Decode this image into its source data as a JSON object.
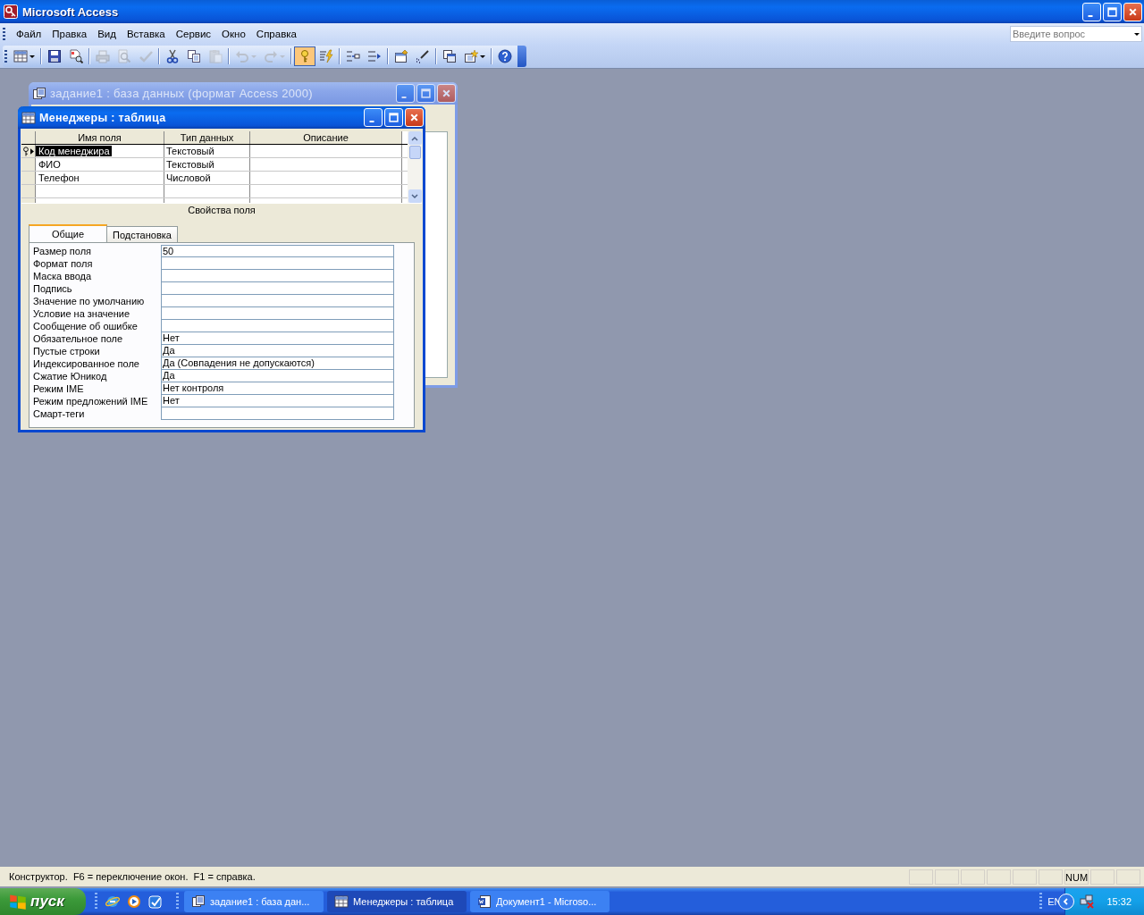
{
  "window": {
    "title": "Microsoft Access"
  },
  "menu": [
    {
      "label": "Файл"
    },
    {
      "label": "Правка"
    },
    {
      "label": "Вид"
    },
    {
      "label": "Вставка"
    },
    {
      "label": "Сервис"
    },
    {
      "label": "Окно"
    },
    {
      "label": "Справка"
    }
  ],
  "help_search": {
    "placeholder": "Введите вопрос"
  },
  "toolbar": [
    [
      {
        "kind": "view",
        "disabled": false,
        "pressed": false,
        "dropdown": true
      }
    ],
    [
      {
        "kind": "save",
        "disabled": false,
        "pressed": false,
        "dropdown": false
      },
      {
        "kind": "file-search",
        "disabled": false,
        "pressed": false,
        "dropdown": false
      }
    ],
    [
      {
        "kind": "print",
        "disabled": true,
        "pressed": false,
        "dropdown": false
      },
      {
        "kind": "preview",
        "disabled": true,
        "pressed": false,
        "dropdown": false
      },
      {
        "kind": "spelling",
        "disabled": true,
        "pressed": false,
        "dropdown": false
      }
    ],
    [
      {
        "kind": "cut",
        "disabled": false,
        "pressed": false,
        "dropdown": false
      },
      {
        "kind": "copy",
        "disabled": false,
        "pressed": false,
        "dropdown": false
      },
      {
        "kind": "paste",
        "disabled": true,
        "pressed": false,
        "dropdown": false
      }
    ],
    [
      {
        "kind": "undo",
        "disabled": true,
        "pressed": false,
        "dropdown": true
      },
      {
        "kind": "redo",
        "disabled": true,
        "pressed": false,
        "dropdown": true
      }
    ],
    [
      {
        "kind": "primary-key",
        "disabled": false,
        "pressed": true,
        "dropdown": false
      },
      {
        "kind": "build",
        "disabled": false,
        "pressed": false,
        "dropdown": false
      }
    ],
    [
      {
        "kind": "insert-rows",
        "disabled": false,
        "pressed": false,
        "dropdown": false
      },
      {
        "kind": "delete-rows",
        "disabled": false,
        "pressed": false,
        "dropdown": false
      }
    ],
    [
      {
        "kind": "properties",
        "disabled": false,
        "pressed": false,
        "dropdown": false
      },
      {
        "kind": "builder",
        "disabled": false,
        "pressed": false,
        "dropdown": false
      }
    ],
    [
      {
        "kind": "database-window",
        "disabled": false,
        "pressed": false,
        "dropdown": false
      },
      {
        "kind": "new-object",
        "disabled": false,
        "pressed": false,
        "dropdown": true
      }
    ],
    [
      {
        "kind": "help",
        "disabled": false,
        "pressed": false,
        "dropdown": false
      }
    ]
  ],
  "database_window": {
    "title": "задание1 : база данных (формат Access 2000)",
    "active": false
  },
  "table_window": {
    "title": "Менеджеры : таблица",
    "active": true
  },
  "design_grid": {
    "columns": [
      "Имя поля",
      "Тип данных",
      "Описание"
    ],
    "rows": [
      {
        "field_name": "Код менеджира",
        "data_type": "Текстовый",
        "primary_key": true,
        "selected": true
      },
      {
        "field_name": "ФИО",
        "data_type": "Текстовый",
        "primary_key": false,
        "selected": false
      },
      {
        "field_name": "Телефон",
        "data_type": "Числовой",
        "primary_key": false,
        "selected": false
      }
    ]
  },
  "field_properties_caption": "Свойства поля",
  "property_tabs": [
    {
      "label": "Общие",
      "selected": true
    },
    {
      "label": "Подстановка",
      "selected": false
    }
  ],
  "properties": [
    {
      "label": "Размер поля",
      "value": "50"
    },
    {
      "label": "Формат поля"
    },
    {
      "label": "Маска ввода"
    },
    {
      "label": "Подпись"
    },
    {
      "label": "Значение по умолчанию"
    },
    {
      "label": "Условие на значение"
    },
    {
      "label": "Сообщение об ошибке"
    },
    {
      "label": "Обязательное поле",
      "value": "Нет"
    },
    {
      "label": "Пустые строки",
      "value": "Да"
    },
    {
      "label": "Индексированное поле",
      "value": "Да (Совпадения не допускаются)"
    },
    {
      "label": "Сжатие Юникод",
      "value": "Да"
    },
    {
      "label": "Режим IME",
      "value": "Нет контроля"
    },
    {
      "label": "Режим предложений IME",
      "value": "Нет"
    },
    {
      "label": "Смарт-теги"
    }
  ],
  "status_bar": {
    "text": "Конструктор.  F6 = переключение окон.  F1 = справка.",
    "indicator": "NUM"
  },
  "taskbar": {
    "start_label": "пуск",
    "quick_launch": [
      {
        "kind": "browser"
      },
      {
        "kind": "media"
      },
      {
        "kind": "app"
      }
    ],
    "tasks": [
      {
        "kind": "database",
        "label": "задание1 : база дан...",
        "selected": false
      },
      {
        "kind": "table",
        "label": "Менеджеры : таблица",
        "selected": true
      },
      {
        "kind": "word",
        "label": "Документ1 - Microso...",
        "selected": false
      }
    ],
    "language": "EN",
    "clock": "15:32"
  }
}
